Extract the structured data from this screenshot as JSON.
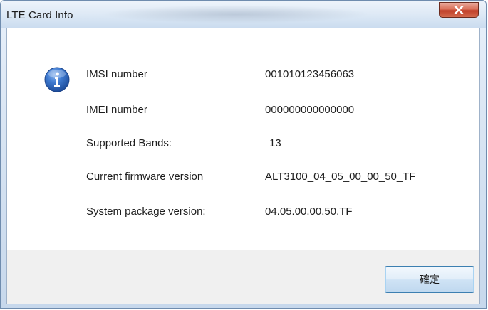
{
  "window": {
    "title": "LTE Card Info"
  },
  "icons": {
    "title_close": "close-icon",
    "message": "info-icon"
  },
  "info": [
    {
      "label": "IMSI number",
      "value": "001010123456063"
    },
    {
      "label": "IMEI number",
      "value": "000000000000000"
    },
    {
      "label": "Supported Bands:",
      "value": "13"
    },
    {
      "label": "Current firmware version",
      "value": "ALT3100_04_05_00_00_50_TF"
    },
    {
      "label": "System package version:",
      "value": "04.05.00.00.50.TF"
    }
  ],
  "buttons": {
    "ok_label": "確定"
  },
  "colors": {
    "close_button": "#c7472f",
    "info_icon": "#2d63b7",
    "footer_bg": "#f0f0f0",
    "default_button_border": "#3c7fb1"
  }
}
